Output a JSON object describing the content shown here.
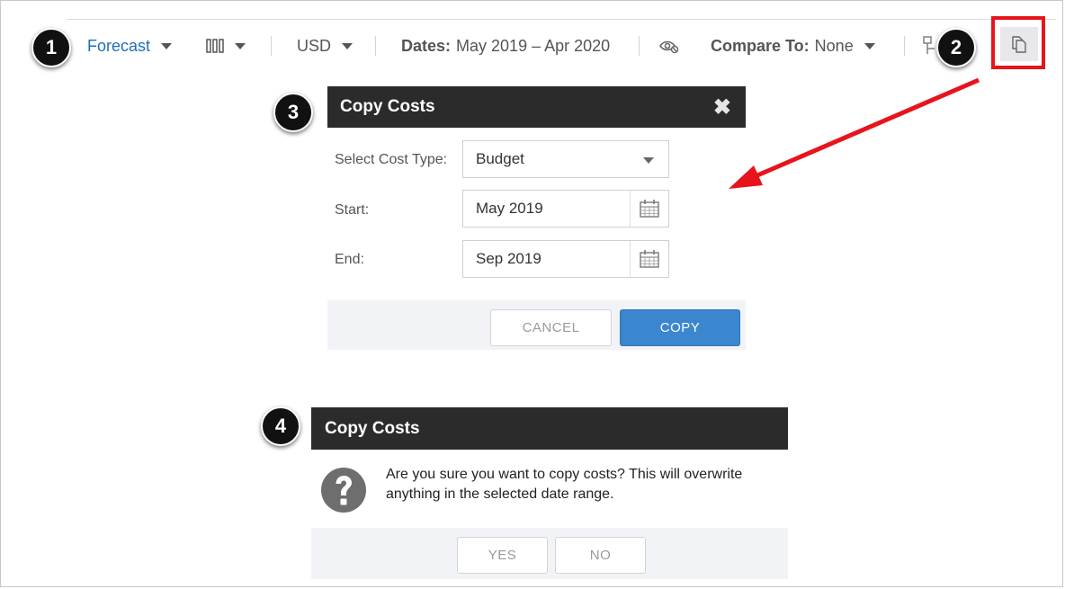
{
  "toolbar": {
    "forecast_label": "Forecast",
    "currency": "USD",
    "dates_label": "Dates:",
    "dates_value": "May 2019 – Apr 2020",
    "compare_label": "Compare To:",
    "compare_value": "None"
  },
  "badges": [
    "1",
    "2",
    "3",
    "4"
  ],
  "copy_dialog": {
    "title": "Copy Costs",
    "cost_type_label": "Select Cost Type:",
    "cost_type_value": "Budget",
    "start_label": "Start:",
    "start_value": "May 2019",
    "end_label": "End:",
    "end_value": "Sep 2019",
    "cancel_label": "CANCEL",
    "copy_label": "COPY"
  },
  "confirm_dialog": {
    "title": "Copy Costs",
    "message_line1": "Are you sure you want to copy costs? This will overwrite",
    "message_line2": "anything in the selected date range.",
    "yes_label": "YES",
    "no_label": "NO"
  },
  "colors": {
    "accent_blue": "#1f6fb5",
    "highlight_red": "#e8141b",
    "primary_button": "#3a87d0",
    "dialog_header": "#2b2b2b"
  }
}
